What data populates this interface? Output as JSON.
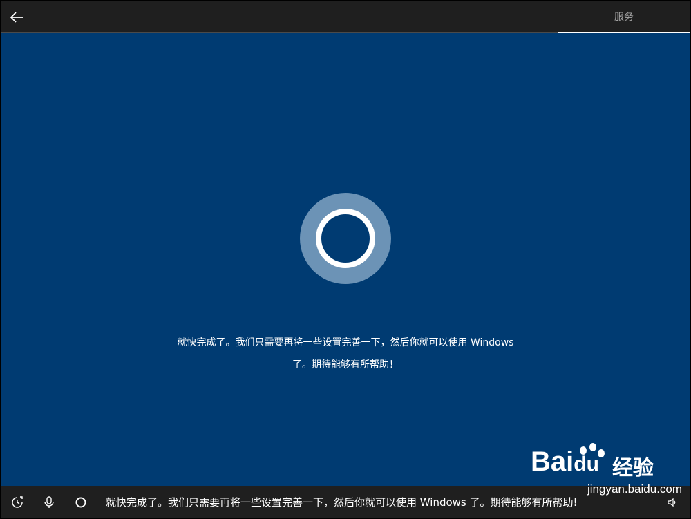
{
  "header": {
    "back_icon": "back-arrow-icon",
    "section_tab": "服务"
  },
  "main": {
    "background_color": "#003b72",
    "cortana_icon": "cortana-ring-icon",
    "message_line1": "就快完成了。我们只需要再将一些设置完善一下，然后你就可以使用 Windows",
    "message_line2": "了。期待能够有所帮助！"
  },
  "taskbar": {
    "accessibility_icon": "ease-of-access-icon",
    "mic_icon": "microphone-icon",
    "cortana_icon": "cortana-circle-icon",
    "caption": "就快完成了。我们只需要再将一些设置完善一下，然后你就可以使用 Windows 了。期待能够有所帮助!",
    "volume_icon": "volume-icon"
  },
  "watermark": {
    "brand_latin": "Bai",
    "brand_du": "du",
    "brand_cn": "经验",
    "url": "jingyan.baidu.com"
  }
}
